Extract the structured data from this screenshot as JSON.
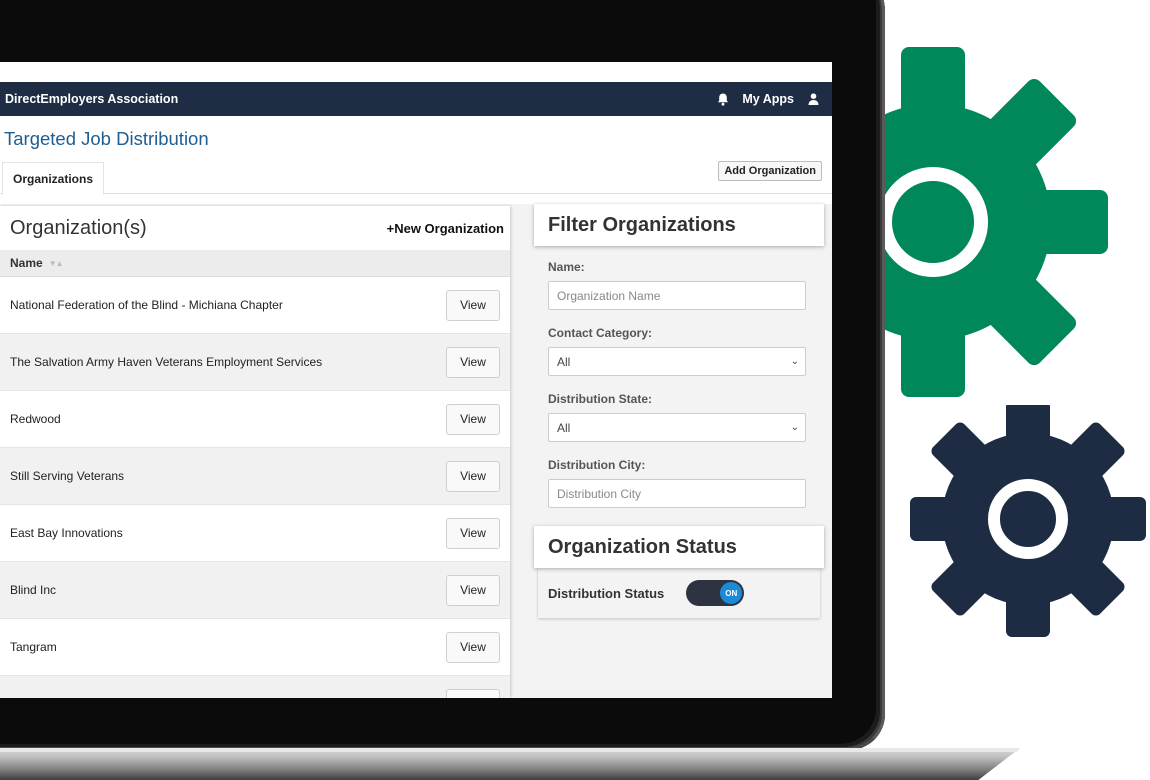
{
  "navbar": {
    "brand": "DirectEmployers Association",
    "my_apps": "My Apps",
    "bell_icon": "bell-icon",
    "user_icon": "user-icon"
  },
  "page": {
    "title": "Targeted Job Distribution",
    "tab_label": "Organizations",
    "add_org_label": "Add Organization"
  },
  "organizations": {
    "title": "Organization(s)",
    "new_label": "+New Organization",
    "column_name": "Name",
    "view_label": "View",
    "rows": [
      "National Federation of the Blind - Michiana Chapter",
      "The Salvation Army Haven Veterans Employment Services",
      "Redwood",
      "Still Serving Veterans",
      "East Bay Innovations",
      "Blind Inc",
      "Tangram"
    ]
  },
  "filter": {
    "title": "Filter Organizations",
    "name_label": "Name:",
    "name_placeholder": "Organization Name",
    "category_label": "Contact Category:",
    "category_value": "All",
    "state_label": "Distribution State:",
    "state_value": "All",
    "city_label": "Distribution City:",
    "city_placeholder": "Distribution City"
  },
  "status": {
    "title": "Organization Status",
    "label": "Distribution Status",
    "toggle_text": "ON"
  },
  "colors": {
    "navbar": "#1e2d44",
    "title_blue": "#1f5e93",
    "gear_green": "#00875a",
    "gear_navy": "#1d2b43",
    "toggle_knob": "#1c8ad6"
  }
}
